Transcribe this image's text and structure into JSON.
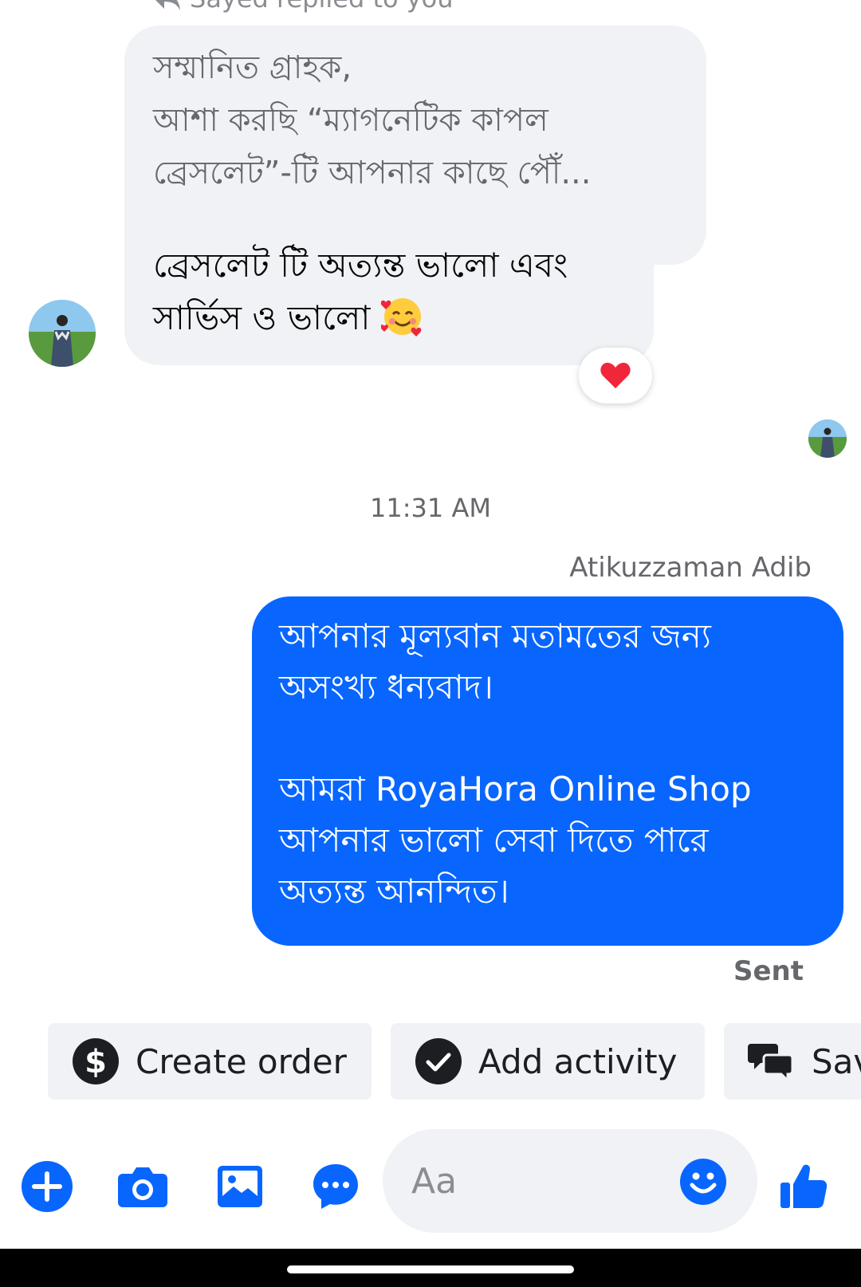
{
  "reply_header": {
    "label": "Sayed replied to you"
  },
  "quoted_message": {
    "lines": [
      "সম্মানিত গ্রাহক,",
      "আশা করছি “ম্যাগনেটিক কাপল",
      "ব্রেসলেট”-টি আপনার কাছে পৌঁ..."
    ]
  },
  "received_message": {
    "lines": [
      "ব্রেসলেট টি অত্যন্ত ভালো এবং",
      "সার্ভিস ও ভালো"
    ],
    "emoji": "smiling-face-with-hearts",
    "reaction": "heart"
  },
  "timestamp": "11:31 AM",
  "sent_message": {
    "sender": "Atikuzzaman Adib",
    "lines": [
      "আপনার মূল্যবান মতামতের জন্য",
      "অসংখ্য ধন্যবাদ।",
      "",
      "আমরা RoyaHora Online Shop",
      "আপনার ভালো সেবা দিতে পারে",
      "অত্যন্ত আনন্দিত।"
    ],
    "status": "Sent"
  },
  "quick_actions": [
    {
      "label": "Create order",
      "icon": "dollar-icon"
    },
    {
      "label": "Add activity",
      "icon": "check-circle-icon"
    },
    {
      "label": "Sav",
      "icon": "chat-bubbles-icon"
    }
  ],
  "composer": {
    "placeholder": "Aa",
    "icons": [
      "plus-icon",
      "camera-icon",
      "image-icon",
      "chat-more-icon",
      "emoji-icon",
      "thumbs-up-icon"
    ]
  },
  "colors": {
    "accent": "#0866ff",
    "bubble_gray": "#f0f2f5",
    "secondary_text": "#65676b"
  }
}
